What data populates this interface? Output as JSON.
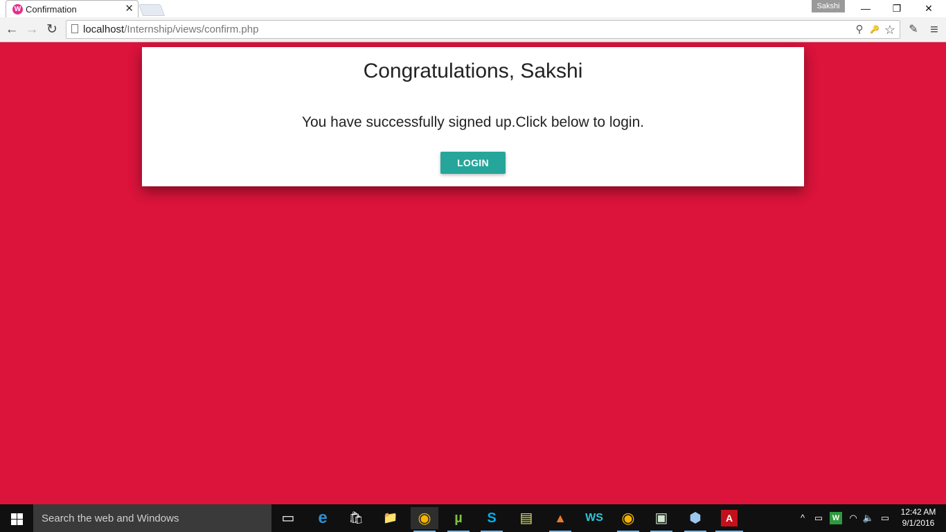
{
  "browser": {
    "tab": {
      "title": "Confirmation",
      "favicon_letter": "W",
      "close_glyph": "✕"
    },
    "profile_name": "Sakshi",
    "window_controls": {
      "minimize": "—",
      "restore": "❐",
      "close": "✕"
    },
    "nav": {
      "back": "←",
      "forward": "→",
      "reload": "↻"
    },
    "url": {
      "host": "localhost",
      "path": "/Internship/views/confirm.php"
    },
    "omnibox_icons": {
      "zoom": "⚲",
      "key": "🔑",
      "bookmark": "☆"
    },
    "extension_icons": {
      "ext": "✎",
      "menu": "≡"
    }
  },
  "page": {
    "title": "Congratulations, Sakshi",
    "message": "You have successfully signed up.Click below to login.",
    "login_label": "LOGIN",
    "accent": "#dc143c",
    "button_color": "#26a69a"
  },
  "taskbar": {
    "search_placeholder": "Search the web and Windows",
    "apps": [
      {
        "name": "task-view-icon",
        "glyph": "▭"
      },
      {
        "name": "edge-icon",
        "glyph": "e"
      },
      {
        "name": "store-icon",
        "glyph": "🛍"
      },
      {
        "name": "file-explorer-icon",
        "glyph": "📁"
      },
      {
        "name": "chrome-icon",
        "glyph": "◉"
      },
      {
        "name": "utorrent-icon",
        "glyph": "µ"
      },
      {
        "name": "skype-icon",
        "glyph": "S"
      },
      {
        "name": "notes-icon",
        "glyph": "▤"
      },
      {
        "name": "matlab-icon",
        "glyph": "▲"
      },
      {
        "name": "webstorm-icon",
        "glyph": "WS"
      },
      {
        "name": "chrome-icon-2",
        "glyph": "◉"
      },
      {
        "name": "app-window-icon",
        "glyph": "▣"
      },
      {
        "name": "virtualbox-icon",
        "glyph": "⬢"
      },
      {
        "name": "acrobat-icon",
        "glyph": "A"
      }
    ],
    "tray": {
      "chevron": "^",
      "battery": "▭",
      "wamp": "W",
      "wifi": "◠",
      "volume": "🔈",
      "notifications": "▭"
    },
    "clock": {
      "time": "12:42 AM",
      "date": "9/1/2016"
    }
  }
}
